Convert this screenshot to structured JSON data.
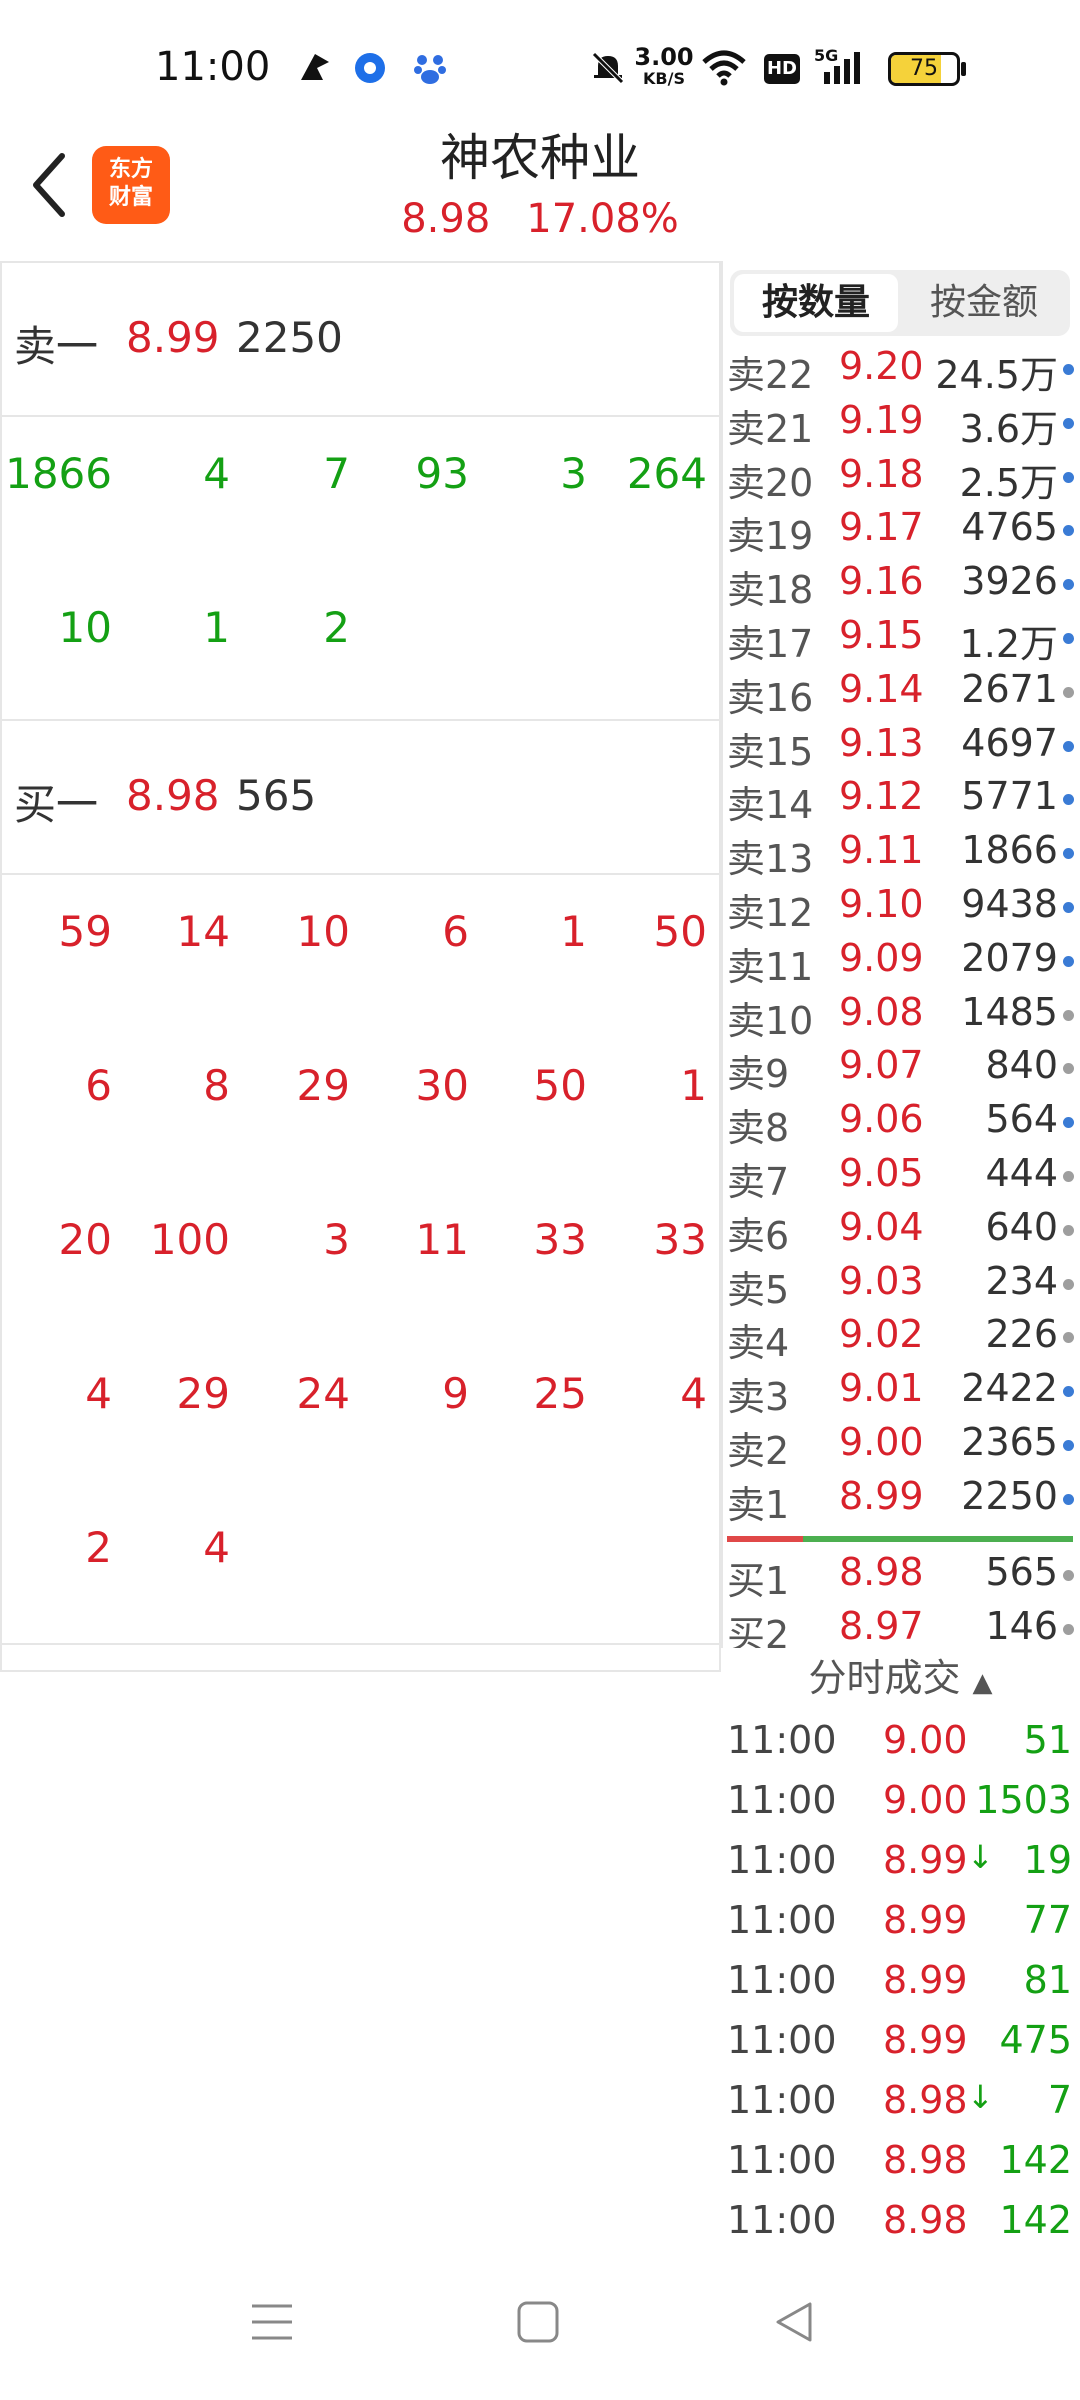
{
  "status_bar": {
    "time": "11:00",
    "net_speed_value": "3.00",
    "net_speed_unit": "KB/S",
    "battery": "75",
    "network": "5G",
    "hd": "HD"
  },
  "header": {
    "logo_line1": "东方",
    "logo_line2": "财富",
    "title": "神农种业",
    "price": "8.98",
    "change_pct": "17.08%"
  },
  "left": {
    "sell1_label": "卖一",
    "sell1_price": "8.99",
    "sell1_volume": "2250",
    "sell_queue": [
      "1866",
      "4",
      "7",
      "93",
      "3",
      "264",
      "10",
      "1",
      "2"
    ],
    "buy1_label": "买一",
    "buy1_price": "8.98",
    "buy1_volume": "565",
    "buy_queue": [
      "59",
      "14",
      "10",
      "6",
      "1",
      "50",
      "6",
      "8",
      "29",
      "30",
      "50",
      "1",
      "20",
      "100",
      "3",
      "11",
      "33",
      "33",
      "4",
      "29",
      "24",
      "9",
      "25",
      "4",
      "2",
      "4"
    ]
  },
  "right": {
    "tab_quantity": "按数量",
    "tab_amount": "按金额",
    "asks": [
      {
        "label": "卖22",
        "price": "9.20",
        "volume": "24.5万",
        "dot": "#3a7bd5"
      },
      {
        "label": "卖21",
        "price": "9.19",
        "volume": "3.6万",
        "dot": "#3a7bd5"
      },
      {
        "label": "卖20",
        "price": "9.18",
        "volume": "2.5万",
        "dot": "#3a7bd5"
      },
      {
        "label": "卖19",
        "price": "9.17",
        "volume": "4765",
        "dot": "#3a7bd5"
      },
      {
        "label": "卖18",
        "price": "9.16",
        "volume": "3926",
        "dot": "#3a7bd5"
      },
      {
        "label": "卖17",
        "price": "9.15",
        "volume": "1.2万",
        "dot": "#3a7bd5"
      },
      {
        "label": "卖16",
        "price": "9.14",
        "volume": "2671",
        "dot": "#9e9e9e"
      },
      {
        "label": "卖15",
        "price": "9.13",
        "volume": "4697",
        "dot": "#3a7bd5"
      },
      {
        "label": "卖14",
        "price": "9.12",
        "volume": "5771",
        "dot": "#3a7bd5"
      },
      {
        "label": "卖13",
        "price": "9.11",
        "volume": "1866",
        "dot": "#3a7bd5"
      },
      {
        "label": "卖12",
        "price": "9.10",
        "volume": "9438",
        "dot": "#3a7bd5"
      },
      {
        "label": "卖11",
        "price": "9.09",
        "volume": "2079",
        "dot": "#3a7bd5"
      },
      {
        "label": "卖10",
        "price": "9.08",
        "volume": "1485",
        "dot": "#9e9e9e"
      },
      {
        "label": "卖9",
        "price": "9.07",
        "volume": "840",
        "dot": "#9e9e9e"
      },
      {
        "label": "卖8",
        "price": "9.06",
        "volume": "564",
        "dot": "#3a7bd5"
      },
      {
        "label": "卖7",
        "price": "9.05",
        "volume": "444",
        "dot": "#9e9e9e"
      },
      {
        "label": "卖6",
        "price": "9.04",
        "volume": "640",
        "dot": "#9e9e9e"
      },
      {
        "label": "卖5",
        "price": "9.03",
        "volume": "234",
        "dot": "#9e9e9e"
      },
      {
        "label": "卖4",
        "price": "9.02",
        "volume": "226",
        "dot": "#9e9e9e"
      },
      {
        "label": "卖3",
        "price": "9.01",
        "volume": "2422",
        "dot": "#3a7bd5"
      },
      {
        "label": "卖2",
        "price": "9.00",
        "volume": "2365",
        "dot": "#3a7bd5"
      },
      {
        "label": "卖1",
        "price": "8.99",
        "volume": "2250",
        "dot": "#3a7bd5"
      }
    ],
    "bids": [
      {
        "label": "买1",
        "price": "8.98",
        "volume": "565",
        "dot": "#9e9e9e"
      },
      {
        "label": "买2",
        "price": "8.97",
        "volume": "146",
        "dot": "#9e9e9e"
      }
    ],
    "trades_title": "分时成交",
    "trades": [
      {
        "time": "11:00",
        "price": "9.00",
        "arrow": "",
        "volume": "51"
      },
      {
        "time": "11:00",
        "price": "9.00",
        "arrow": "",
        "volume": "1503"
      },
      {
        "time": "11:00",
        "price": "8.99",
        "arrow": "↓",
        "volume": "19"
      },
      {
        "time": "11:00",
        "price": "8.99",
        "arrow": "",
        "volume": "77"
      },
      {
        "time": "11:00",
        "price": "8.99",
        "arrow": "",
        "volume": "81"
      },
      {
        "time": "11:00",
        "price": "8.99",
        "arrow": "",
        "volume": "475"
      },
      {
        "time": "11:00",
        "price": "8.98",
        "arrow": "↓",
        "volume": "7"
      },
      {
        "time": "11:00",
        "price": "8.98",
        "arrow": "",
        "volume": "142"
      },
      {
        "time": "11:00",
        "price": "8.98",
        "arrow": "",
        "volume": "142"
      }
    ]
  },
  "colors": {
    "up": "#d8212b",
    "down": "#14a014",
    "accent_blue": "#3a7bd5",
    "logo": "#ff5b16"
  }
}
